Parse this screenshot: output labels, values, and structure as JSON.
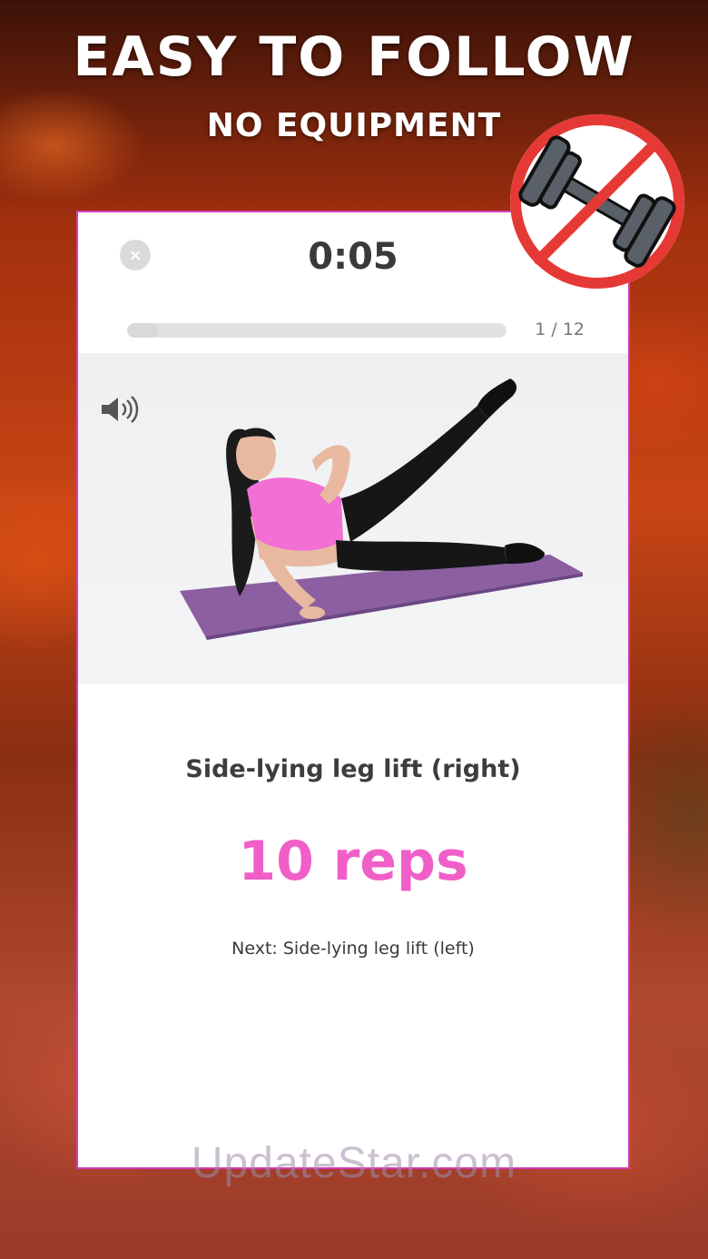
{
  "promo": {
    "headline": "EASY TO FOLLOW",
    "subheadline": "NO EQUIPMENT",
    "badge_icon": "no-dumbbell-icon"
  },
  "workout": {
    "close_icon": "×",
    "timer": "0:05",
    "progress": {
      "current": 1,
      "total": 12,
      "label": "1 / 12",
      "fraction": 0.0833
    },
    "sound_icon": "speaker-icon",
    "exercise_name": "Side-lying leg lift (right)",
    "reps": "10 reps",
    "next": "Next: Side-lying leg lift (left)"
  },
  "watermark": "UpdateStar.com",
  "colors": {
    "accent_pink": "#f05fc8",
    "card_border": "#d63ab6",
    "badge_red": "#e53935",
    "mat_purple": "#8b5fa0",
    "top_pink": "#f26fd3"
  }
}
